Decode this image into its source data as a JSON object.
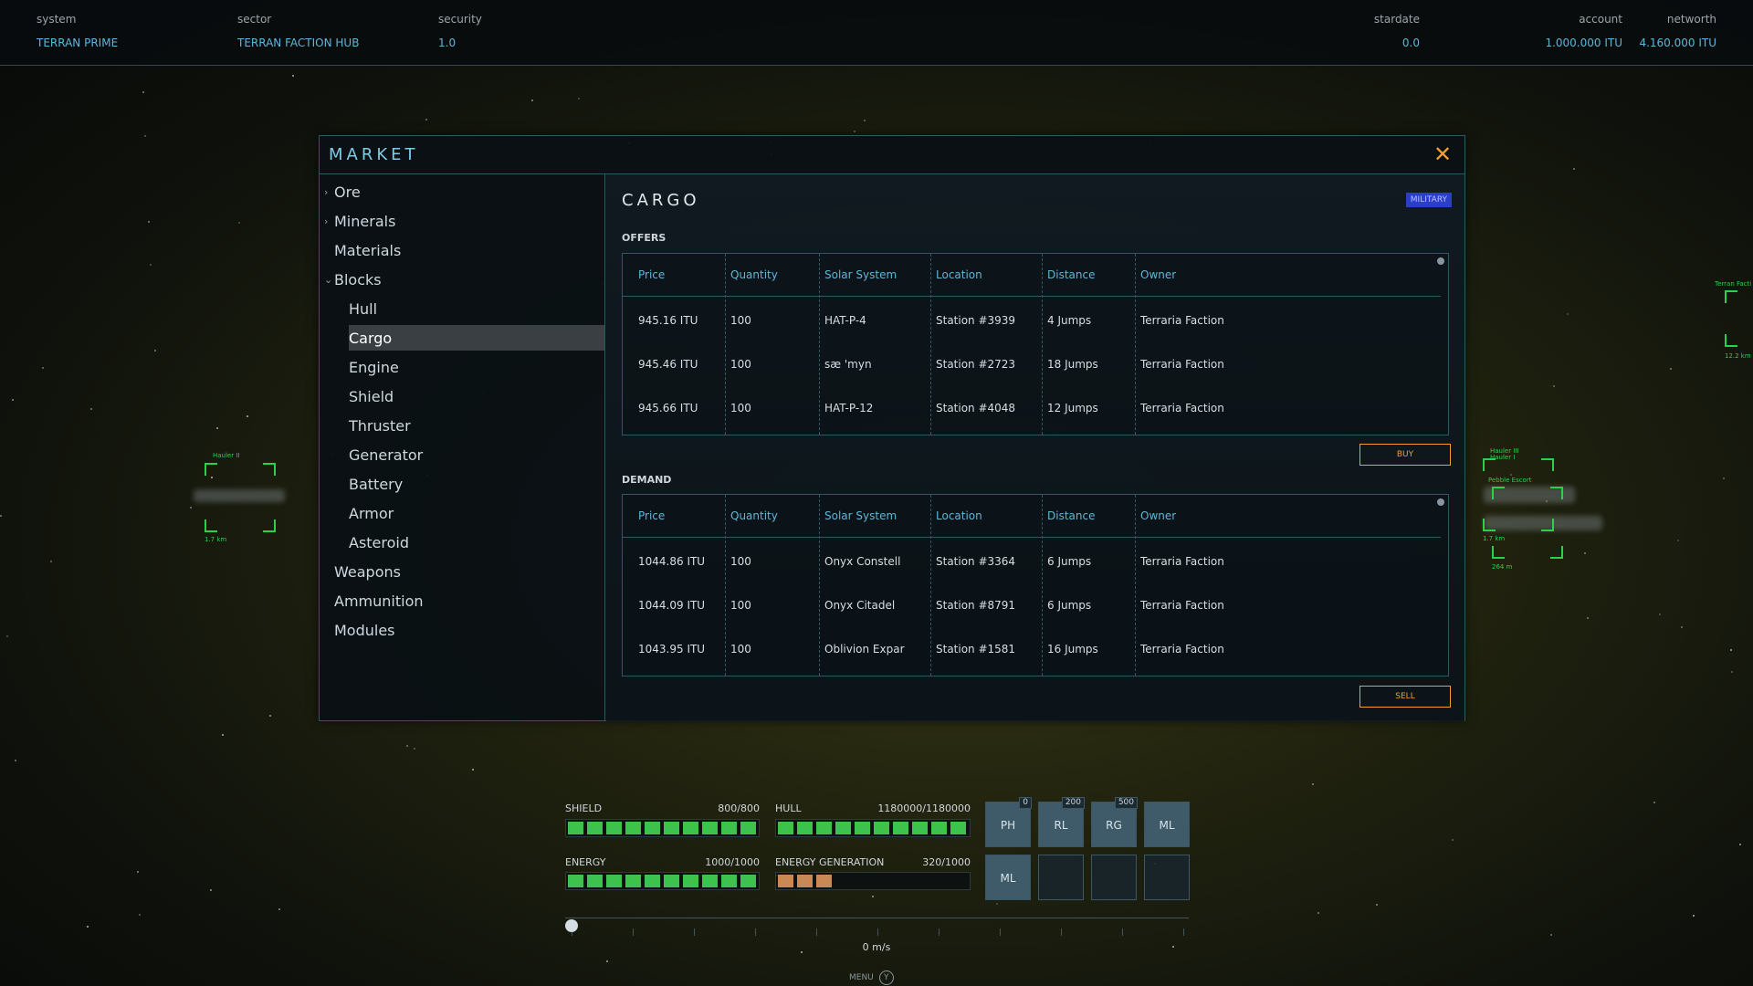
{
  "topbar": {
    "system": {
      "label": "system",
      "value": "TERRAN PRIME"
    },
    "sector": {
      "label": "sector",
      "value": "TERRAN FACTION HUB"
    },
    "security": {
      "label": "security",
      "value": "1.0"
    },
    "stardate": {
      "label": "stardate",
      "value": "0.0"
    },
    "account": {
      "label": "account",
      "value": "1.000.000 ITU"
    },
    "networth": {
      "label": "networth",
      "value": "4.160.000 ITU"
    }
  },
  "ships": {
    "left": {
      "name": "Hauler II",
      "distance": "1.7 km"
    },
    "right_top": {
      "name1": "Hauler III",
      "name2": "Hauler I",
      "name3": "Pebble Escort",
      "distance1": "1.7 km",
      "distance2": "264 m"
    },
    "far_right": {
      "name": "Terran Facti",
      "distance": "12.2 km"
    }
  },
  "market": {
    "title": "MARKET",
    "close_icon": "close-icon",
    "categories": [
      {
        "label": "Ore",
        "expandable": true,
        "expanded": false,
        "level": 0
      },
      {
        "label": "Minerals",
        "expandable": true,
        "expanded": false,
        "level": 0
      },
      {
        "label": "Materials",
        "expandable": false,
        "level": 0
      },
      {
        "label": "Blocks",
        "expandable": true,
        "expanded": true,
        "level": 0
      },
      {
        "label": "Hull",
        "level": 1
      },
      {
        "label": "Cargo",
        "level": 1,
        "selected": true
      },
      {
        "label": "Engine",
        "level": 1
      },
      {
        "label": "Shield",
        "level": 1
      },
      {
        "label": "Thruster",
        "level": 1
      },
      {
        "label": "Generator",
        "level": 1
      },
      {
        "label": "Battery",
        "level": 1
      },
      {
        "label": "Armor",
        "level": 1
      },
      {
        "label": "Asteroid",
        "level": 1
      },
      {
        "label": "Weapons",
        "level": 0
      },
      {
        "label": "Ammunition",
        "level": 0
      },
      {
        "label": "Modules",
        "level": 0
      }
    ],
    "content": {
      "title": "CARGO",
      "badge": "MILITARY",
      "columns": [
        "Price",
        "Quantity",
        "Solar System",
        "Location",
        "Distance",
        "Owner"
      ],
      "offers": {
        "label": "OFFERS",
        "rows": [
          [
            "945.16 ITU",
            "100",
            "HAT-P-4",
            "Station #3939",
            "4 Jumps",
            "Terraria Faction"
          ],
          [
            "945.46 ITU",
            "100",
            "sæ 'myn",
            "Station #2723",
            "18 Jumps",
            "Terraria Faction"
          ],
          [
            "945.66 ITU",
            "100",
            "HAT-P-12",
            "Station #4048",
            "12 Jumps",
            "Terraria Faction"
          ]
        ],
        "button": "BUY"
      },
      "demand": {
        "label": "DEMAND",
        "rows": [
          [
            "1044.86 ITU",
            "100",
            "Onyx Constell",
            "Station #3364",
            "6 Jumps",
            "Terraria Faction"
          ],
          [
            "1044.09 ITU",
            "100",
            "Onyx Citadel",
            "Station #8791",
            "6 Jumps",
            "Terraria Faction"
          ],
          [
            "1043.95 ITU",
            "100",
            "Oblivion Expar",
            "Station #1581",
            "16 Jumps",
            "Terraria Faction"
          ]
        ],
        "button": "SELL"
      }
    }
  },
  "hud": {
    "shield": {
      "label": "SHIELD",
      "value": "800/800",
      "fill": 1.0
    },
    "hull": {
      "label": "HULL",
      "value": "1180000/1180000",
      "fill": 1.0
    },
    "energy": {
      "label": "ENERGY",
      "value": "1000/1000",
      "fill": 1.0
    },
    "energy_gen": {
      "label": "ENERGY GENERATION",
      "value": "320/1000",
      "fill": 0.32
    },
    "slots": [
      {
        "label": "PH",
        "count": "0"
      },
      {
        "label": "RL",
        "count": "200"
      },
      {
        "label": "RG",
        "count": "500"
      },
      {
        "label": "ML",
        "count": ""
      },
      {
        "label": "ML",
        "count": ""
      },
      {
        "label": "",
        "count": ""
      },
      {
        "label": "",
        "count": ""
      },
      {
        "label": "",
        "count": ""
      }
    ],
    "speed": "0 m/s",
    "menu": "MENU",
    "menu_key": "Y",
    "colors": {
      "bar_green": "#3dc24d",
      "bar_orange": "#c88955",
      "accent_orange": "#f0a030",
      "accent_blue": "#5fb6d8"
    }
  }
}
